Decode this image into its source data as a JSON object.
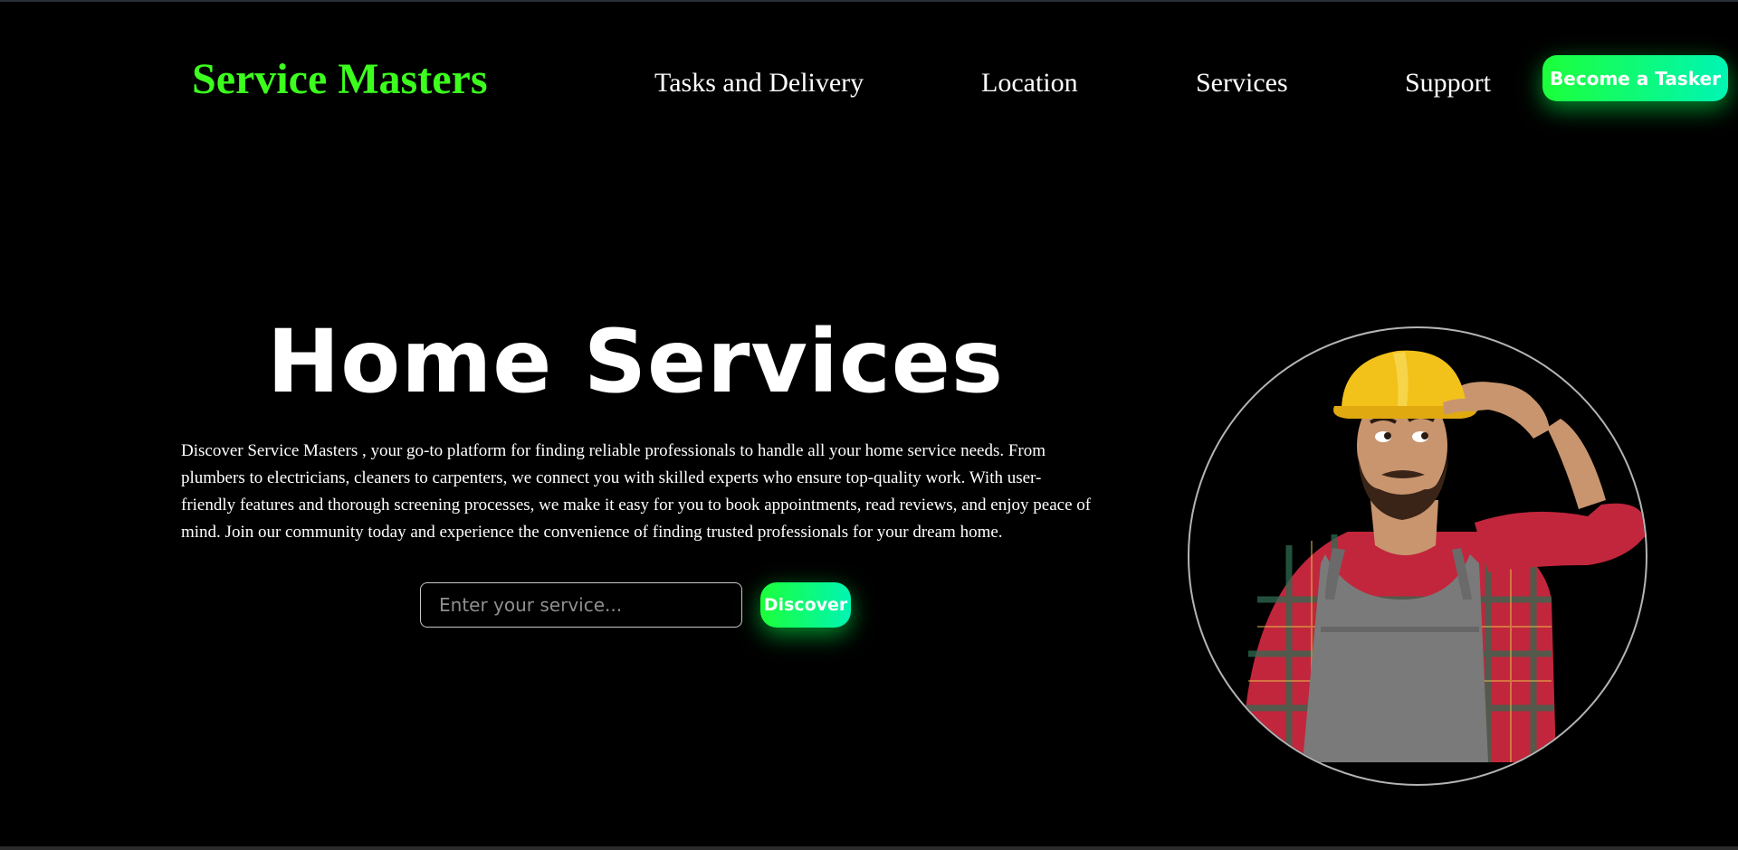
{
  "brand": {
    "name": "Service Masters",
    "accent_color": "#3cff1e"
  },
  "nav": {
    "links": [
      {
        "label": "Tasks and Delivery"
      },
      {
        "label": "Location"
      },
      {
        "label": "Services"
      },
      {
        "label": "Support"
      }
    ],
    "cta_label": "Become a Tasker"
  },
  "hero": {
    "title": "Home Services",
    "description": "Discover Service Masters , your go-to platform for finding reliable professionals to handle all your home service needs. From plumbers to electricians, cleaners to carpenters, we connect you with skilled experts who ensure top-quality work. With user-friendly features and thorough screening processes, we make it easy for you to book appointments, read reviews, and enjoy peace of mind. Join our community today and experience the convenience of finding trusted professionals for your dream home.",
    "search": {
      "placeholder": "Enter your service...",
      "value": ""
    },
    "discover_label": "Discover",
    "image": {
      "subject": "worker-with-hard-hat",
      "icon": "worker-photo"
    }
  },
  "theme": {
    "background": "#000000",
    "button_gradient": [
      "#1cff3a",
      "#00f5b4"
    ],
    "text_color": "#ffffff"
  }
}
